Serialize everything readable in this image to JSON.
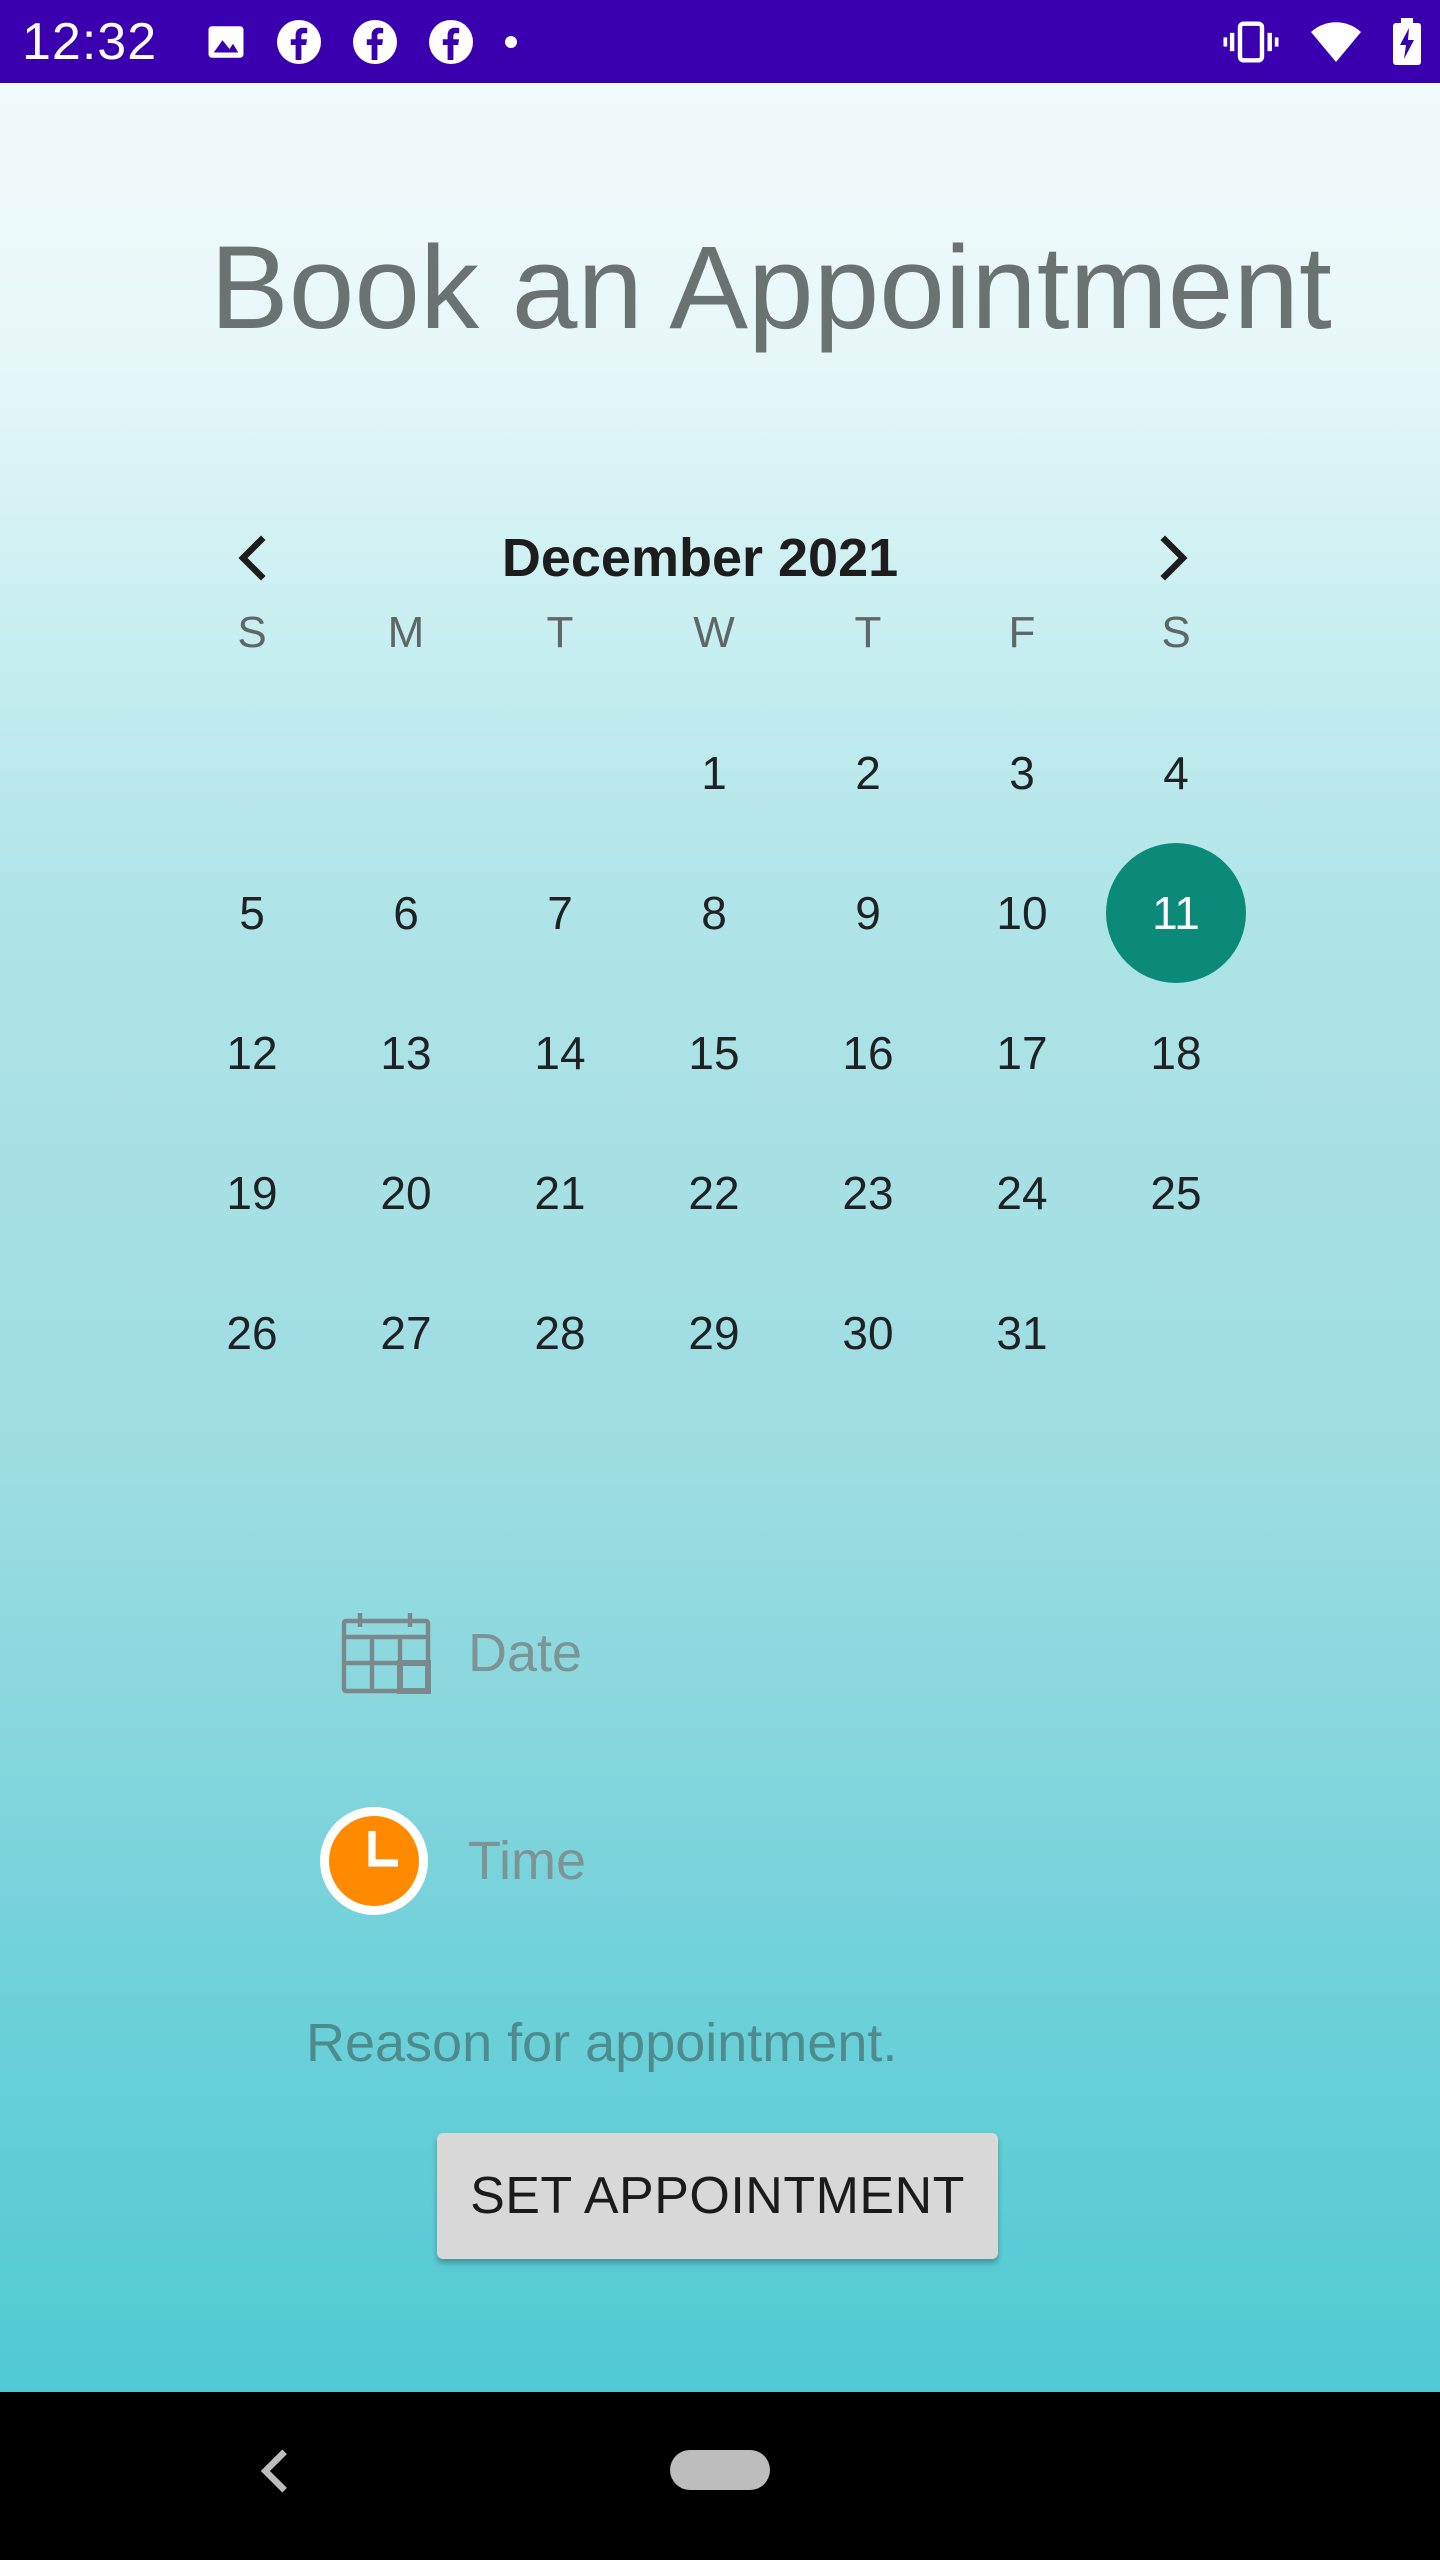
{
  "status_bar": {
    "time": "12:32",
    "left_icons": [
      "image-icon",
      "facebook-icon",
      "facebook-icon",
      "facebook-icon",
      "dot-icon"
    ],
    "right_icons": [
      "vibrate-icon",
      "wifi-icon",
      "battery-charging-icon"
    ],
    "background": "#3a00b0"
  },
  "page": {
    "title": "Book an Appointment"
  },
  "calendar": {
    "month_label": "December 2021",
    "weekdays": [
      "S",
      "M",
      "T",
      "W",
      "T",
      "F",
      "S"
    ],
    "weeks": [
      [
        "",
        "",
        "",
        "1",
        "2",
        "3",
        "4"
      ],
      [
        "5",
        "6",
        "7",
        "8",
        "9",
        "10",
        "11"
      ],
      [
        "12",
        "13",
        "14",
        "15",
        "16",
        "17",
        "18"
      ],
      [
        "19",
        "20",
        "21",
        "22",
        "23",
        "24",
        "25"
      ],
      [
        "26",
        "27",
        "28",
        "29",
        "30",
        "31",
        ""
      ]
    ],
    "selected_day": "11",
    "selected_color": "#0b8a7a"
  },
  "form": {
    "date_label": "Date",
    "time_label": "Time",
    "reason_placeholder": "Reason for appointment.",
    "submit_label": "SET APPOINTMENT"
  },
  "colors": {
    "clock_icon": "#ff8a00"
  }
}
